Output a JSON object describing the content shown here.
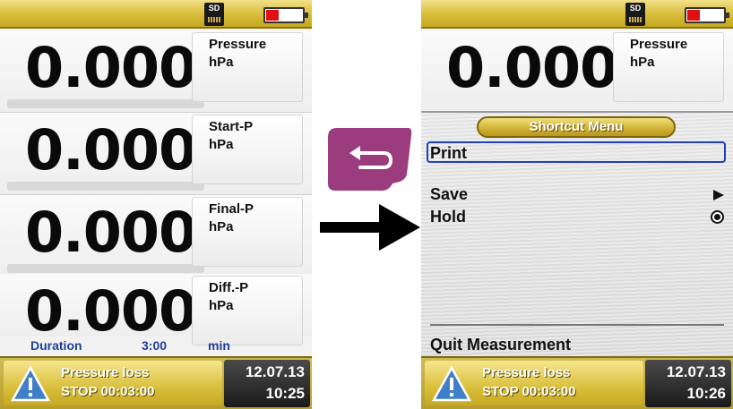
{
  "status_icons": {
    "sd_label": "SD",
    "battery_level": "low",
    "battery_color": "#e01010"
  },
  "left_screen": {
    "rows": [
      {
        "value": "0.000",
        "label": "Pressure",
        "unit": "hPa"
      },
      {
        "value": "0.000",
        "label": "Start-P",
        "unit": "hPa"
      },
      {
        "value": "0.000",
        "label": "Final-P",
        "unit": "hPa"
      },
      {
        "value": "0.000",
        "label": "Diff.-P",
        "unit": "hPa"
      }
    ],
    "duration": {
      "label": "Duration",
      "value": "3:00",
      "unit": "min"
    },
    "status": {
      "line1": "Pressure loss",
      "line2": "STOP 00:03:00",
      "date": "12.07.13",
      "time": "10:25"
    }
  },
  "right_screen": {
    "row": {
      "value": "0.000",
      "label": "Pressure",
      "unit": "hPa"
    },
    "menu": {
      "title": "Shortcut Menu",
      "items": [
        {
          "label": "Print",
          "selected": true
        },
        {
          "label": "Save",
          "indicator": "submenu-arrow"
        },
        {
          "label": "Hold",
          "indicator": "radio-selected"
        }
      ],
      "quit_label": "Quit Measurement"
    },
    "status": {
      "line1": "Pressure loss",
      "line2": "STOP 00:03:00",
      "date": "12.07.13",
      "time": "10:26"
    }
  },
  "between": {
    "key_icon": "back-return-icon",
    "key_color": "#9b3c7e",
    "arrow_icon": "arrow-right-icon"
  },
  "colors": {
    "accent_gold": "#d8bc3a",
    "duration_blue": "#1f3f9a",
    "selection_blue": "#1f3fbf"
  }
}
